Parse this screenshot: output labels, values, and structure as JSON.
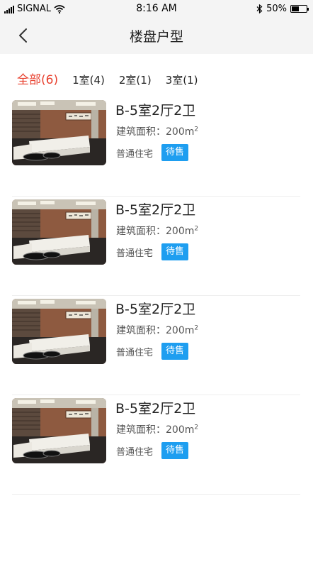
{
  "status_bar": {
    "carrier": "SIGNAL",
    "time": "8:16 AM",
    "battery": "50%",
    "battery_level": 0.5
  },
  "header": {
    "title": "楼盘户型"
  },
  "tabs": [
    {
      "label": "全部(6)",
      "active": true
    },
    {
      "label": "1室(4)",
      "active": false
    },
    {
      "label": "2室(1)",
      "active": false
    },
    {
      "label": "3室(1)",
      "active": false
    }
  ],
  "units": [
    {
      "name": "B-5室2厅2卫",
      "area_label": "建筑面积：",
      "area_value": "200m",
      "area_unit_sup": "2",
      "property_type": "普通住宅",
      "status": "待售"
    },
    {
      "name": "B-5室2厅2卫",
      "area_label": "建筑面积：",
      "area_value": "200m",
      "area_unit_sup": "2",
      "property_type": "普通住宅",
      "status": "待售"
    },
    {
      "name": "B-5室2厅2卫",
      "area_label": "建筑面积：",
      "area_value": "200m",
      "area_unit_sup": "2",
      "property_type": "普通住宅",
      "status": "待售"
    },
    {
      "name": "B-5室2厅2卫",
      "area_label": "建筑面积：",
      "area_value": "200m",
      "area_unit_sup": "2",
      "property_type": "普通住宅",
      "status": "待售"
    }
  ],
  "colors": {
    "accent_active_tab": "#e8412f",
    "status_badge": "#1e9ef0",
    "header_bg": "#f4f4f4"
  }
}
